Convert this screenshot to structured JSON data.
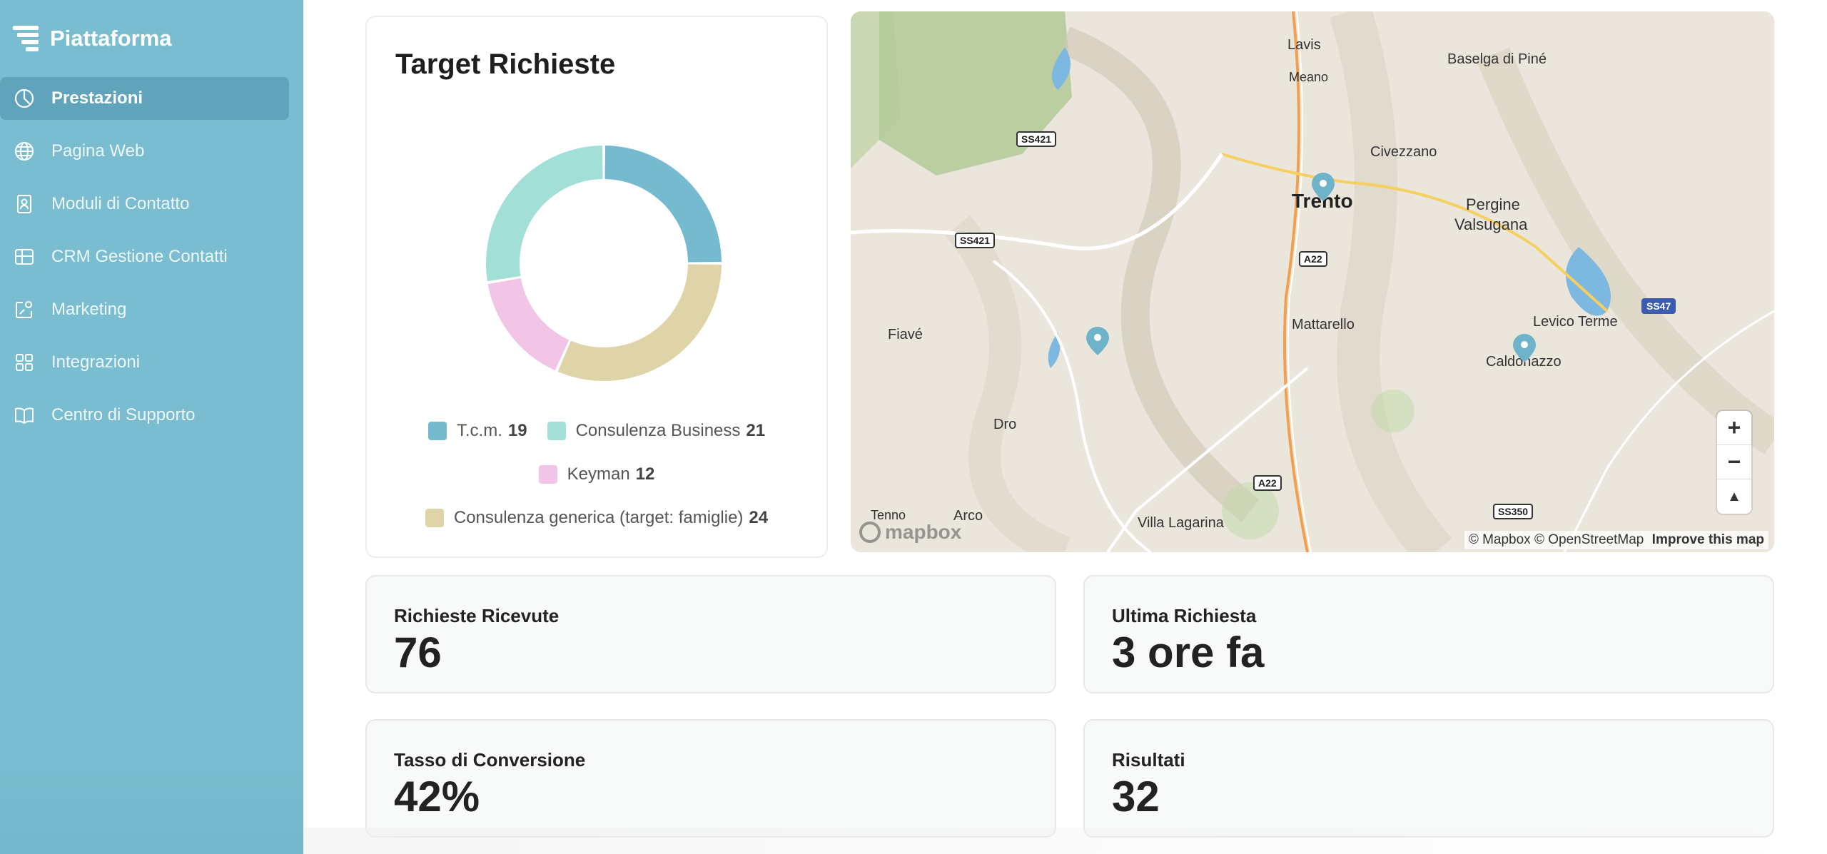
{
  "brand": {
    "name": "Piattaforma"
  },
  "sidebar": {
    "items": [
      {
        "label": "Prestazioni",
        "icon": "pie-chart-icon",
        "active": true
      },
      {
        "label": "Pagina Web",
        "icon": "globe-icon"
      },
      {
        "label": "Moduli di Contatto",
        "icon": "contact-form-icon"
      },
      {
        "label": "CRM Gestione Contatti",
        "icon": "crm-table-icon"
      },
      {
        "label": "Marketing",
        "icon": "marketing-icon"
      },
      {
        "label": "Integrazioni",
        "icon": "grid-apps-icon"
      },
      {
        "label": "Centro di Supporto",
        "icon": "book-icon"
      }
    ]
  },
  "donut": {
    "title": "Target Richieste",
    "legend": [
      {
        "label": "T.c.m.",
        "value": "19",
        "color": "#76bad0"
      },
      {
        "label": "Consulenza Business",
        "value": "21",
        "color": "#a2e0d7"
      },
      {
        "label": "Keyman",
        "value": "12",
        "color": "#f2c4e6"
      },
      {
        "label": "Consulenza generica (target: famiglie)",
        "value": "24",
        "color": "#dfd3a8"
      }
    ]
  },
  "chart_data": {
    "type": "pie",
    "title": "Target Richieste",
    "categories": [
      "T.c.m.",
      "Consulenza generica (target: famiglie)",
      "Keyman",
      "Consulenza Business"
    ],
    "values": [
      19,
      24,
      12,
      21
    ],
    "colors": [
      "#76bad0",
      "#dfd3a8",
      "#f2c4e6",
      "#a2e0d7"
    ]
  },
  "map": {
    "places": [
      "Lavis",
      "Meano",
      "Baselga di Piné",
      "Civezzano",
      "Trento",
      "Pergine",
      "Valsugana",
      "Fiavé",
      "Mattarello",
      "Levico Terme",
      "Caldonazzo",
      "Dro",
      "Tenno",
      "Arco",
      "Villa Lagarina"
    ],
    "roads": [
      "SS421",
      "SS421",
      "A22",
      "A22",
      "SS47",
      "SS350"
    ],
    "zoom_in": "+",
    "zoom_out": "−",
    "compass": "▲",
    "attribution_1": "© Mapbox",
    "attribution_2": "© OpenStreetMap",
    "improve": "Improve this map",
    "logo": "mapbox"
  },
  "stats": {
    "received_label": "Richieste Ricevute",
    "received_value": "76",
    "last_label": "Ultima Richiesta",
    "last_value": "3 ore fa",
    "conversion_label": "Tasso di Conversione",
    "conversion_value": "42%",
    "results_label": "Risultati",
    "results_value": "32"
  }
}
